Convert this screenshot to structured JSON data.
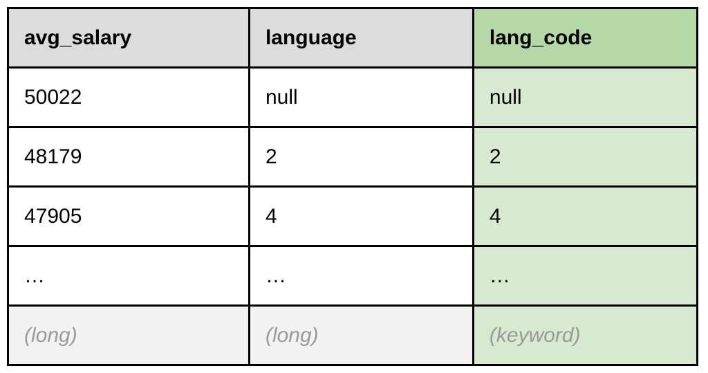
{
  "table": {
    "headers": [
      "avg_salary",
      "language",
      "lang_code"
    ],
    "rows": [
      [
        "50022",
        "null",
        "null"
      ],
      [
        "48179",
        "2",
        "2"
      ],
      [
        "47905",
        "4",
        "4"
      ],
      [
        "…",
        "…",
        "…"
      ]
    ],
    "types": [
      "(long)",
      "(long)",
      "(keyword)"
    ]
  }
}
